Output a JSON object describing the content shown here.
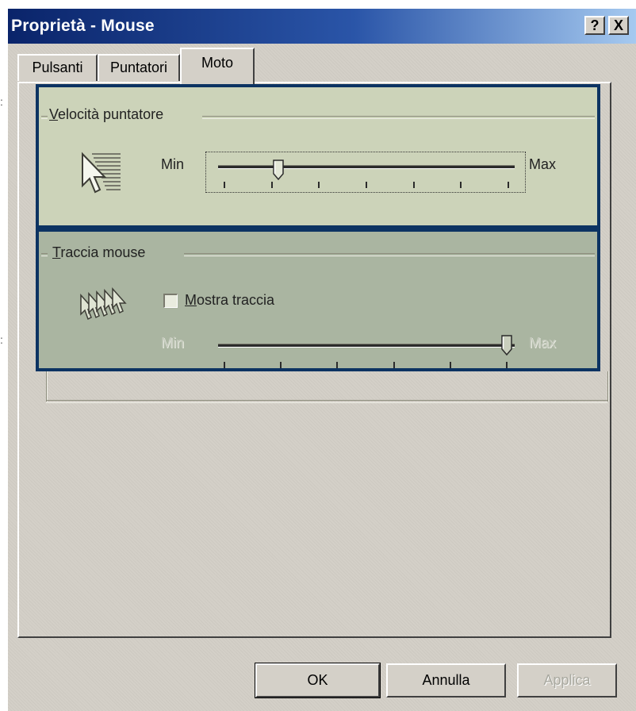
{
  "window": {
    "title": "Proprietà - Mouse",
    "help_button": "?",
    "close_button": "X"
  },
  "tabs": [
    {
      "label": "Pulsanti",
      "selected": false
    },
    {
      "label": "Puntatori",
      "selected": false
    },
    {
      "label": "Moto",
      "selected": true
    }
  ],
  "speed_group": {
    "title_access_key": "V",
    "title_rest": "elocità puntatore",
    "min_label": "Min",
    "max_label": "Max",
    "slider_value_fraction": 0.19,
    "tick_count": 7
  },
  "trail_group": {
    "title_access_key": "T",
    "title_rest": "raccia mouse",
    "checkbox_access_key": "M",
    "checkbox_label_rest": "ostra traccia",
    "checked": false,
    "min_label": "Min",
    "max_label": "Max",
    "slider_value_fraction": 1.0,
    "slider_enabled": false,
    "tick_count": 6
  },
  "buttons": {
    "ok": "OK",
    "cancel": "Annulla",
    "apply": "Applica"
  },
  "colors": {
    "title_gradient_start": "#0a246a",
    "title_gradient_end": "#a6caf0",
    "highlight_border": "#0c3362",
    "speed_group_bg": "#ccd3b9",
    "trail_group_bg": "#aab5a1"
  }
}
